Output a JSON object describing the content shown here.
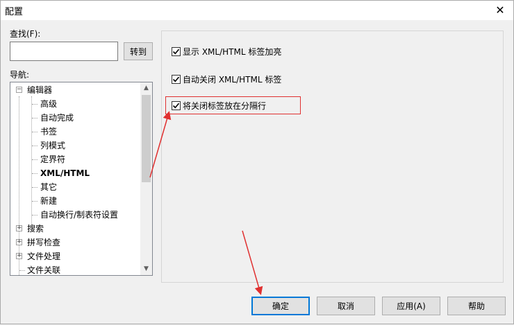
{
  "window": {
    "title": "配置",
    "close_icon": "close-icon"
  },
  "search": {
    "label": "查找(F):",
    "value": "",
    "goto_label": "转到"
  },
  "nav": {
    "label": "导航:",
    "items": [
      {
        "label": "编辑器",
        "level": 0,
        "expander": "⊟"
      },
      {
        "label": "高级",
        "level": 1
      },
      {
        "label": "自动完成",
        "level": 1
      },
      {
        "label": "书签",
        "level": 1
      },
      {
        "label": "列模式",
        "level": 1
      },
      {
        "label": "定界符",
        "level": 1
      },
      {
        "label": "XML/HTML",
        "level": 1,
        "selected": true
      },
      {
        "label": "其它",
        "level": 1
      },
      {
        "label": "新建",
        "level": 1
      },
      {
        "label": "自动换行/制表符设置",
        "level": 1
      },
      {
        "label": "搜索",
        "level": 0,
        "expander": "⊞"
      },
      {
        "label": "拼写检查",
        "level": 0,
        "expander": "⊞"
      },
      {
        "label": "文件处理",
        "level": 0,
        "expander": "⊞"
      },
      {
        "label": "文件关联",
        "level": 0
      }
    ]
  },
  "options": [
    {
      "label": "显示 XML/HTML 标签加亮",
      "checked": true
    },
    {
      "label": "自动关闭 XML/HTML 标签",
      "checked": true
    },
    {
      "label": "将关闭标签放在分隔行",
      "checked": true
    }
  ],
  "buttons": {
    "ok": "确定",
    "cancel": "取消",
    "apply": "应用(A)",
    "help": "帮助"
  },
  "colors": {
    "highlight": "#e03030",
    "accent": "#0078d7"
  }
}
